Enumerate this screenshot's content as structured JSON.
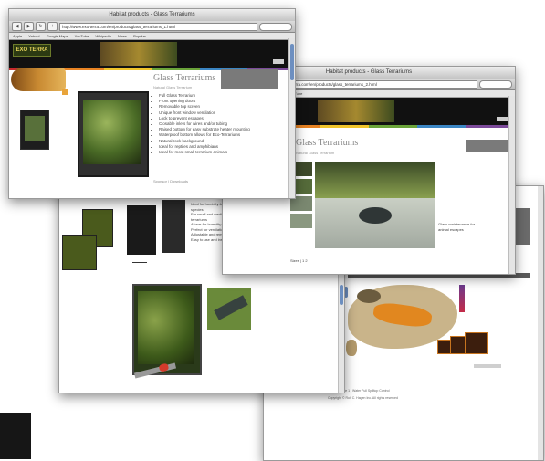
{
  "windows": {
    "front": {
      "title": "Habitat products - Glass Terrariums",
      "url": "http://www.exo-terra.com/en/products/glass_terrariums_1.html",
      "bookmarks": [
        "Apple",
        "Yahoo!",
        "Google Maps",
        "YouTube",
        "Wikipedia",
        "News",
        "Popular"
      ],
      "logo": "EXO TERRA",
      "page_title": "Glass Terrariums",
      "page_subtitle": "Natural Glass Terrarium",
      "features": [
        "Full Glass Terrarium",
        "Front opening doors",
        "Removable top screen",
        "Unique front window ventilation",
        "Lock to prevent escapes",
        "Closable inlets for wires and/or tubing",
        "Raised bottom for easy substrate heater mounting",
        "Waterproof bottom allows for Eco-Terrariums",
        "Natural rock background",
        "Ideal for reptiles and amphibians",
        "Ideal for most small terrarium animals"
      ],
      "footer_links": "Sponsor | Downloads"
    },
    "middle": {
      "title": "Habitat products - Glass Terrariums",
      "url": "http://www.exo-terra.com/en/products/glass_terrariums_2.html",
      "page_title": "Glass Terrariums",
      "page_subtitle": "Natural Glass Terrarium",
      "caption": "Glass maintenance for animal escapes",
      "footer": "Sizes  |  1  2"
    },
    "back_left": {
      "features": [
        "Ideal for humidity-loving species",
        "For small and medium terrariums",
        "Allows for humidity control",
        "Perfect for ventilation",
        "Adjustable and removable",
        "Easy to use and install"
      ]
    },
    "back_right": {
      "status": "Spilltop mode 1 : Water Full Spilltop Control",
      "status2": "Copyright © Rolf C. Hagen Inc. All rights reserved"
    }
  },
  "colors": {
    "black_band": "#111111",
    "scroll_accent": "#6d8fc0",
    "stripe": [
      "#c7292d",
      "#e88323",
      "#f0c42b",
      "#6ba43a",
      "#3b86c4",
      "#7c4a9a"
    ]
  }
}
